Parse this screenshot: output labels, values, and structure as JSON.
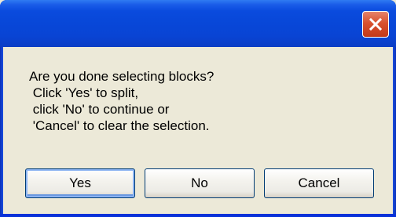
{
  "dialog": {
    "message_lines": [
      "Are you done selecting blocks?",
      " Click 'Yes' to split,",
      " click 'No' to continue or",
      " 'Cancel' to clear the selection."
    ],
    "buttons": {
      "yes": "Yes",
      "no": "No",
      "cancel": "Cancel"
    },
    "close_icon": "close-x-icon"
  },
  "colors": {
    "titlebar": "#0a4bde",
    "close_button": "#d9512e",
    "dialog_body": "#ece9d8",
    "button_border": "#003c74"
  }
}
